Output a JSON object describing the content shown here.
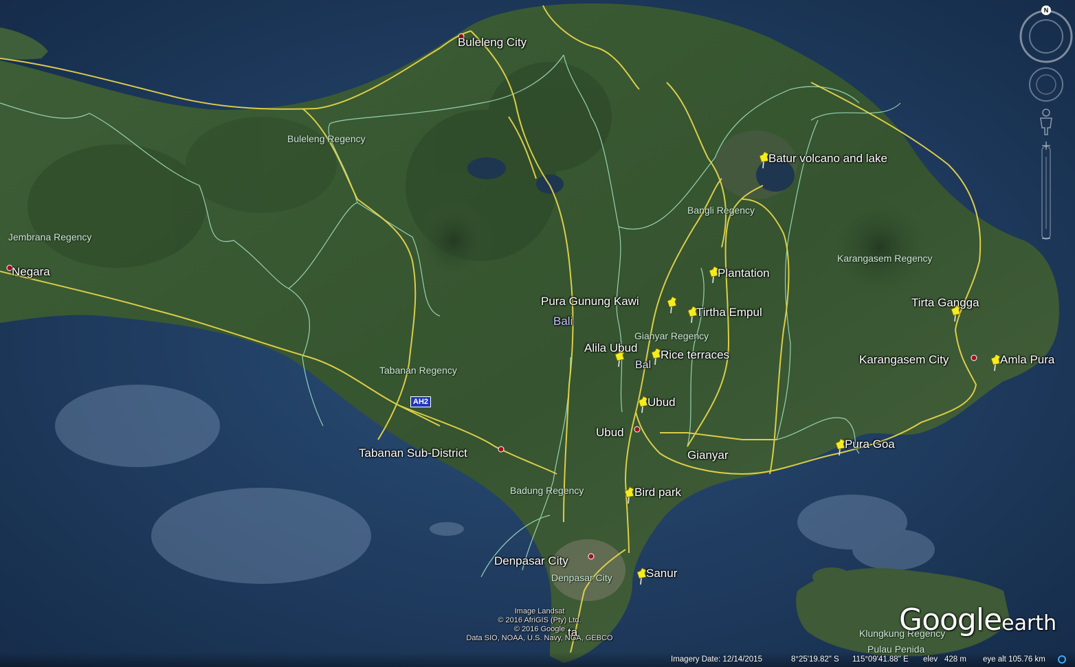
{
  "app": {
    "brand_google": "Google",
    "brand_earth": "earth"
  },
  "colors": {
    "sea": "#1d3a5c",
    "land": "#3a5a34",
    "road": "#e6d44a",
    "boundary": "#a8e8c8",
    "pin": "#f4ec21",
    "city_dot": "#a1121b"
  },
  "cities": [
    {
      "id": "buleleng",
      "label": "Buleleng City"
    },
    {
      "id": "negara",
      "label": "Negara"
    },
    {
      "id": "tabanan",
      "label": "Tabanan Sub-District"
    },
    {
      "id": "denpasar",
      "label": "Denpasar City"
    },
    {
      "id": "karangasem",
      "label": "Karangasem City"
    },
    {
      "id": "ubud-town",
      "label": "Ubud"
    },
    {
      "id": "gianyar",
      "label": "Gianyar"
    },
    {
      "id": "kuta",
      "label": "ta"
    }
  ],
  "regions": [
    {
      "id": "buleleng",
      "label": "Buleleng Regency"
    },
    {
      "id": "jembrana",
      "label": "Jembrana Regency"
    },
    {
      "id": "tabanan",
      "label": "Tabanan Regency"
    },
    {
      "id": "badung",
      "label": "Badung Regency"
    },
    {
      "id": "gianyar",
      "label": "Gianyar Regency"
    },
    {
      "id": "bangli",
      "label": "Bangli Regency"
    },
    {
      "id": "karangasem",
      "label": "Karangasem Regency"
    },
    {
      "id": "denpasar",
      "label": "Denpasar City"
    },
    {
      "id": "klungkung",
      "label": "Klungkung Regency"
    },
    {
      "id": "penida",
      "label": "Pulau Penida"
    }
  ],
  "island_labels": {
    "main": "Bali",
    "sub": "Bal"
  },
  "placemarks": [
    {
      "id": "batur",
      "label": "Batur volcano and lake"
    },
    {
      "id": "plantation",
      "label": "Plantation"
    },
    {
      "id": "gunung-kawi",
      "label": "Pura Gunung Kawi"
    },
    {
      "id": "tirtha-empul",
      "label": "Tirtha Empul"
    },
    {
      "id": "tirta-gangga",
      "label": "Tirta Gangga"
    },
    {
      "id": "alila-ubud",
      "label": "Alila Ubud"
    },
    {
      "id": "rice-terraces",
      "label": "Rice terraces"
    },
    {
      "id": "amla-pura",
      "label": "Amla Pura"
    },
    {
      "id": "ubud",
      "label": "Ubud"
    },
    {
      "id": "pura-goa",
      "label": "Pura Goa"
    },
    {
      "id": "bird-park",
      "label": "Bird park"
    },
    {
      "id": "sanur",
      "label": "Sanur"
    }
  ],
  "road_shield": "AH2",
  "credits": [
    "Image Landsat",
    "© 2016 AfriGIS (Pty) Ltd.",
    "© 2016 Google",
    "Data SIO, NOAA, U.S. Navy, NGA, GEBCO"
  ],
  "status": {
    "imagery_date": "Imagery Date: 12/14/2015",
    "lat": "8°25'19.82\" S",
    "lon": "115°09'41.88\" E",
    "elev_label": "elev",
    "elev": "428 m",
    "eye_alt": "eye alt 105.76 km"
  },
  "nav": {
    "north": "N"
  }
}
